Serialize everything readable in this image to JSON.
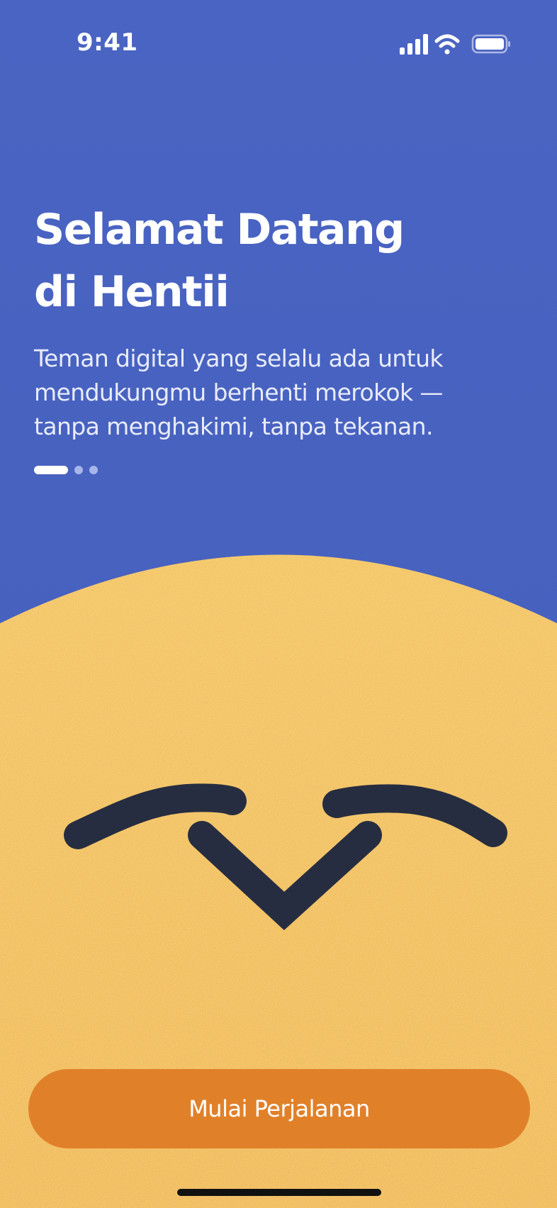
{
  "status_bar": {
    "time": "9:41",
    "icons": [
      "cellular-signal-icon",
      "wifi-icon",
      "battery-icon"
    ]
  },
  "onboarding": {
    "title_line1": "Selamat Datang",
    "title_line2": "di Hentii",
    "subtitle_line1": "Teman digital yang selalu ada untuk",
    "subtitle_line2": "mendukungmu berhenti merokok —",
    "subtitle_line3": "tanpa menghakimi, tanpa tekanan.",
    "pager": {
      "total": 3,
      "active_index": 0
    }
  },
  "mascot": {
    "name": "face-illustration",
    "expression": "happy-closed-eyes"
  },
  "cta": {
    "label": "Mulai Perjalanan"
  },
  "colors": {
    "background_blue": "#4862BF",
    "face_yellow": "#F2BE52",
    "face_features": "#272D40",
    "button_orange": "#E0812A",
    "text_white": "#FFFFFF"
  }
}
